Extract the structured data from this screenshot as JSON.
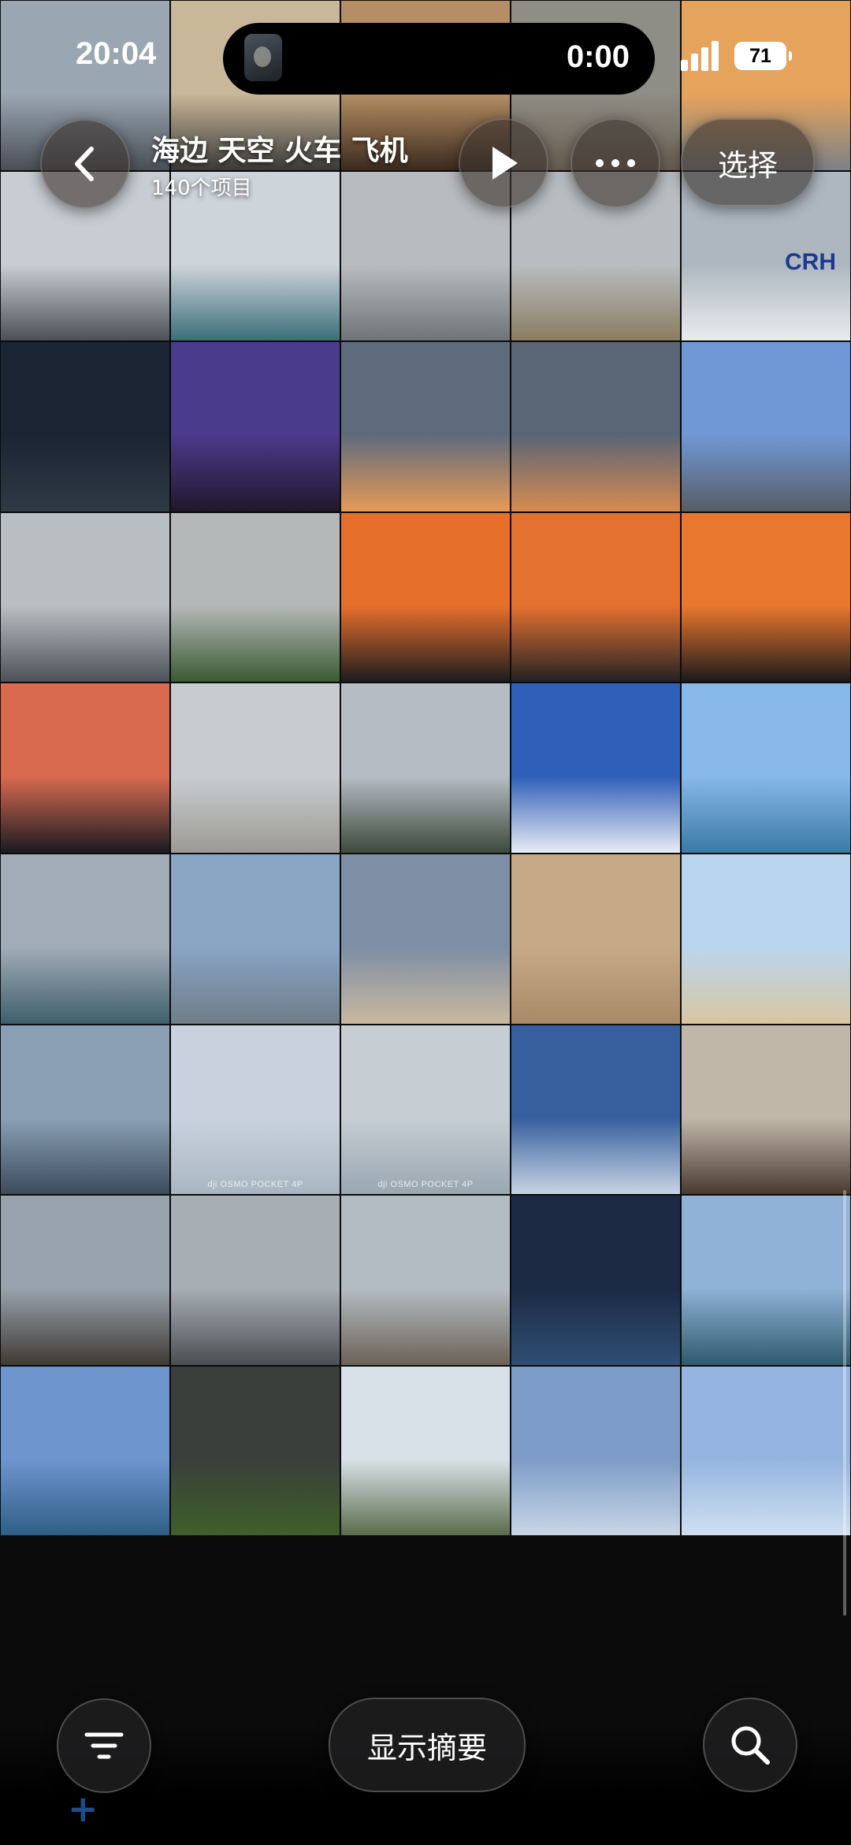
{
  "status_bar": {
    "time": "20:04",
    "timer": "0:00",
    "battery": "71"
  },
  "header": {
    "title": "海边 天空 火车 飞机",
    "subtitle": "140个项目",
    "select_label": "选择"
  },
  "bottom_bar": {
    "summary_label": "显示摘要",
    "add_symbol": "+"
  },
  "photos": [
    {
      "id": "p1",
      "sky": "#9aa6b2",
      "ground": "#4a4f57"
    },
    {
      "id": "p2",
      "sky": "#c9b79a",
      "ground": "#3a3a38"
    },
    {
      "id": "p3",
      "sky": "#b48e64",
      "ground": "#3b2a1e"
    },
    {
      "id": "p4",
      "sky": "#8e8d86",
      "ground": "#6a5e51"
    },
    {
      "id": "p5",
      "sky": "#e6a35b",
      "ground": "#7b8187"
    },
    {
      "id": "p6",
      "sky": "#c7cdd3",
      "ground": "#4d5157"
    },
    {
      "id": "p7",
      "sky": "#cdd4da",
      "ground": "#3b6f7a"
    },
    {
      "id": "p8",
      "sky": "#b9bcbe",
      "ground": "#707478"
    },
    {
      "id": "p9",
      "sky": "#b8bdc1",
      "ground": "#8a7d60"
    },
    {
      "id": "p10",
      "sky": "#aeb7c0",
      "ground": "#e8ecef",
      "crh": "CRH"
    },
    {
      "id": "p11",
      "sky": "#1b2433",
      "ground": "#2f3a46"
    },
    {
      "id": "p12",
      "sky": "#4b3b8c",
      "ground": "#20172a"
    },
    {
      "id": "p13",
      "sky": "#5e6b7d",
      "ground": "#e79a57"
    },
    {
      "id": "p14",
      "sky": "#5a6576",
      "ground": "#d88a4f"
    },
    {
      "id": "p15",
      "sky": "#6f98d4",
      "ground": "#585d67"
    },
    {
      "id": "p16",
      "sky": "#b9bec2",
      "ground": "#4c5259"
    },
    {
      "id": "p17",
      "sky": "#b4b8b8",
      "ground": "#3b5a33"
    },
    {
      "id": "p18",
      "sky": "#e66f2c",
      "ground": "#1d1c1f"
    },
    {
      "id": "p19",
      "sky": "#e3712f",
      "ground": "#232225"
    },
    {
      "id": "p20",
      "sky": "#e9772e",
      "ground": "#1c1a1c"
    },
    {
      "id": "p21",
      "sky": "#d86a4f",
      "ground": "#1a1a22"
    },
    {
      "id": "p22",
      "sky": "#c8ccd0",
      "ground": "#9c9a94"
    },
    {
      "id": "p23",
      "sky": "#b6bcc4",
      "ground": "#3d4a3c"
    },
    {
      "id": "p24",
      "sky": "#2f5fb8",
      "ground": "#e7ecf3"
    },
    {
      "id": "p25",
      "sky": "#87b8e8",
      "ground": "#3c7aa6"
    },
    {
      "id": "p26",
      "sky": "#a2acb6",
      "ground": "#3e5f6c"
    },
    {
      "id": "p27",
      "sky": "#8aa4c4",
      "ground": "#6f7d88"
    },
    {
      "id": "p28",
      "sky": "#7e8ea4",
      "ground": "#c9b8a0"
    },
    {
      "id": "p29",
      "sky": "#c6a987",
      "ground": "#a98a67"
    },
    {
      "id": "p30",
      "sky": "#b9d6ee",
      "ground": "#d9c6a2"
    },
    {
      "id": "p31",
      "sky": "#8a9fb4",
      "ground": "#3b4c5c"
    },
    {
      "id": "p32",
      "sky": "#c9d2dc",
      "ground": "#a9b6c2",
      "wm": "dji OSMO POCKET 4P"
    },
    {
      "id": "p33",
      "sky": "#c6cdd3",
      "ground": "#9aa7b1",
      "wm": "dji OSMO POCKET 4P"
    },
    {
      "id": "p34",
      "sky": "#375f9e",
      "ground": "#c8d4e3"
    },
    {
      "id": "p35",
      "sky": "#c0b7a9",
      "ground": "#4a3a30"
    },
    {
      "id": "p36",
      "sky": "#98a2ad",
      "ground": "#3f3b35"
    },
    {
      "id": "p37",
      "sky": "#a7aeb4",
      "ground": "#4a4f53"
    },
    {
      "id": "p38",
      "sky": "#b4bcc3",
      "ground": "#6b6257"
    },
    {
      "id": "p39",
      "sky": "#1c2a44",
      "ground": "#2f4f74"
    },
    {
      "id": "p40",
      "sky": "#8fb2d6",
      "ground": "#2f5a6d"
    },
    {
      "id": "p41",
      "sky": "#6e95cd",
      "ground": "#2f5f86"
    },
    {
      "id": "p42",
      "sky": "#3a3f3b",
      "ground": "#3f5f2a"
    },
    {
      "id": "p43",
      "sky": "#d9e1e8",
      "ground": "#5a6c4c"
    },
    {
      "id": "p44",
      "sky": "#7d9cc8",
      "ground": "#c9d6e6"
    },
    {
      "id": "p45",
      "sky": "#95b5e0",
      "ground": "#cfdff0"
    }
  ]
}
